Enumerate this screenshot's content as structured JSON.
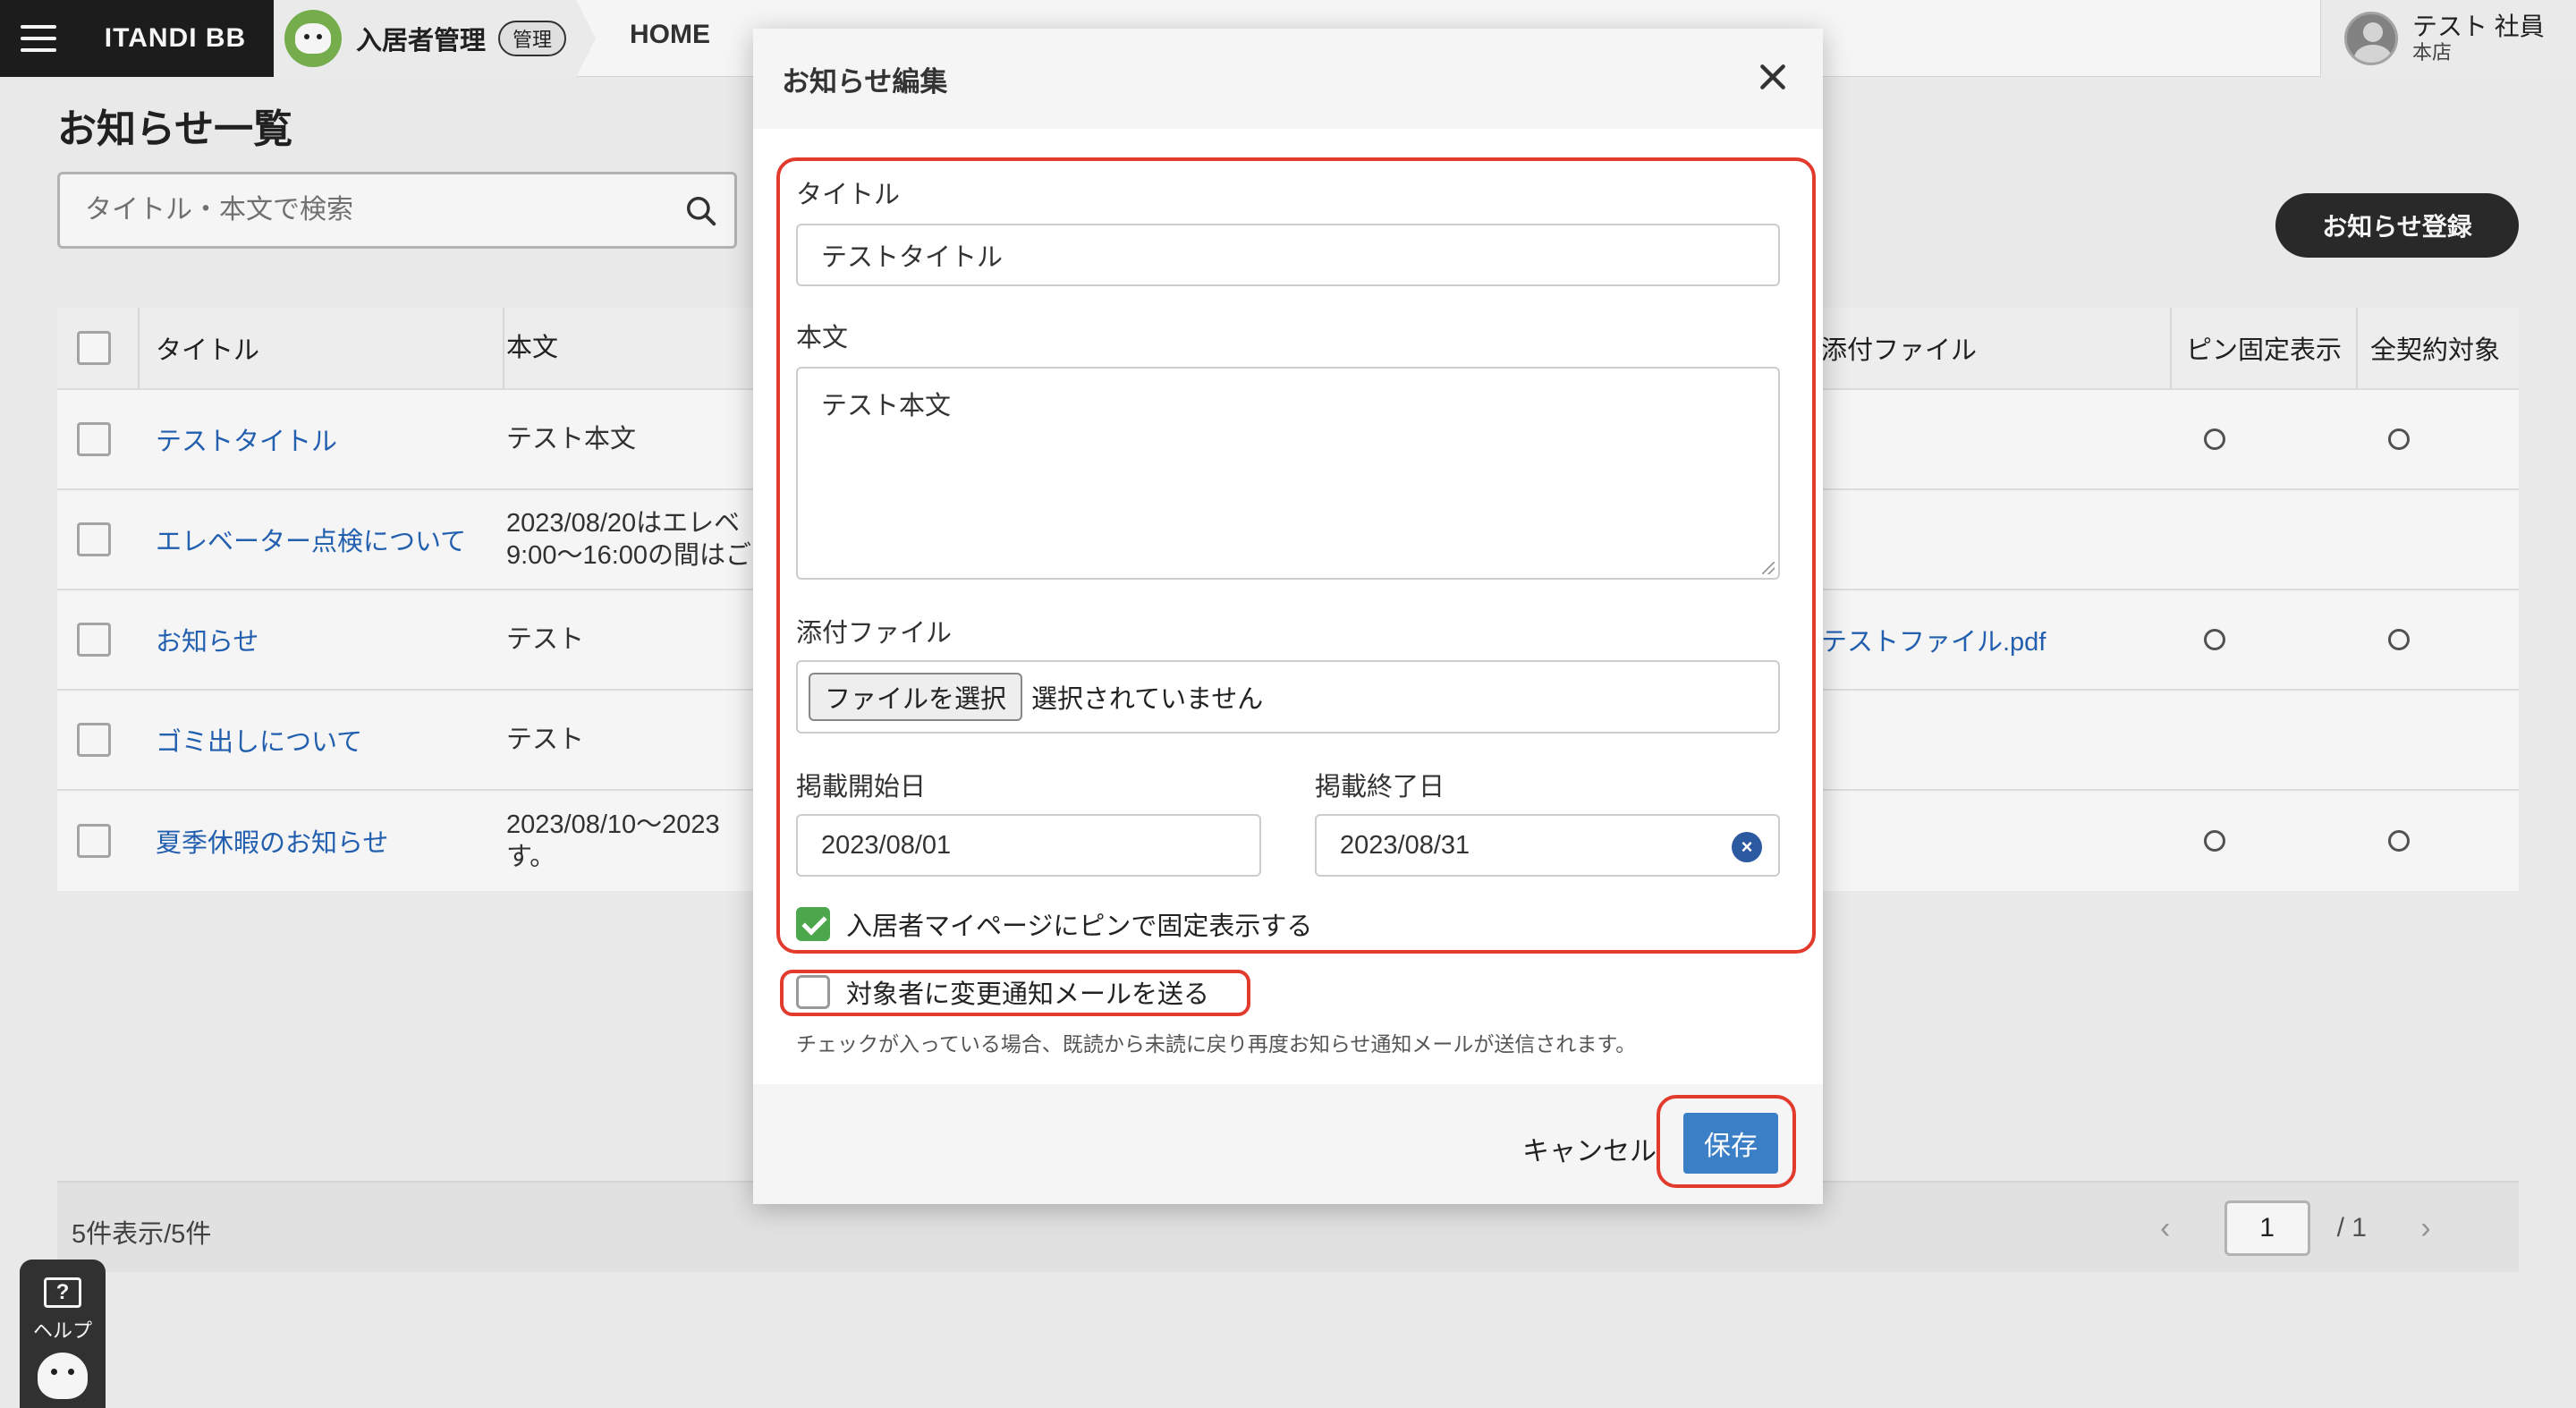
{
  "topbar": {
    "brand": "ITANDI BB",
    "app_name": "入居者管理",
    "app_badge": "管理",
    "nav_home": "HOME",
    "user_name": "テスト 社員",
    "user_branch": "本店"
  },
  "page": {
    "title": "お知らせ一覧",
    "search_placeholder": "タイトル・本文で検索",
    "register_label": "お知らせ登録"
  },
  "table": {
    "headers": {
      "title": "タイトル",
      "body": "本文",
      "file": "添付ファイル",
      "pin": "ピン固定表示",
      "all": "全契約対象"
    },
    "rows": [
      {
        "title": "テストタイトル",
        "body": "テスト本文",
        "file": "",
        "pin": "○",
        "all": "○"
      },
      {
        "title": "エレベーター点検について",
        "body": "2023/08/20はエレベ\n9:00～16:00の間はご",
        "file": "",
        "pin": "",
        "all": ""
      },
      {
        "title": "お知らせ",
        "body": "テスト",
        "file": "テストファイル.pdf",
        "pin": "○",
        "all": "○"
      },
      {
        "title": "ゴミ出しについて",
        "body": "テスト",
        "file": "",
        "pin": "",
        "all": ""
      },
      {
        "title": "夏季休暇のお知らせ",
        "body": "2023/08/10～2023\nす。",
        "file": "",
        "pin": "○",
        "all": "○"
      }
    ]
  },
  "footer": {
    "count": "5件表示/5件",
    "page_current": "1",
    "page_total": "/ 1"
  },
  "help": {
    "label": "ヘルプ",
    "icon": "?"
  },
  "modal": {
    "title": "お知らせ編集",
    "title_label": "タイトル",
    "title_value": "テストタイトル",
    "body_label": "本文",
    "body_value": "テスト本文",
    "file_label": "添付ファイル",
    "file_button": "ファイルを選択",
    "file_status": "選択されていません",
    "start_label": "掲載開始日",
    "start_value": "2023/08/01",
    "end_label": "掲載終了日",
    "end_value": "2023/08/31",
    "pin_label": "入居者マイページにピンで固定表示する",
    "pin_checked": true,
    "notify_label": "対象者に変更通知メールを送る",
    "notify_checked": false,
    "notify_note": "チェックが入っている場合、既読から未読に戻り再度お知らせ通知メールが送信されます。",
    "cancel_label": "キャンセル",
    "save_label": "保存"
  },
  "colors": {
    "highlight": "#e23b2e",
    "link": "#2463b7",
    "save": "#3b80c6",
    "check": "#4ca64c"
  }
}
